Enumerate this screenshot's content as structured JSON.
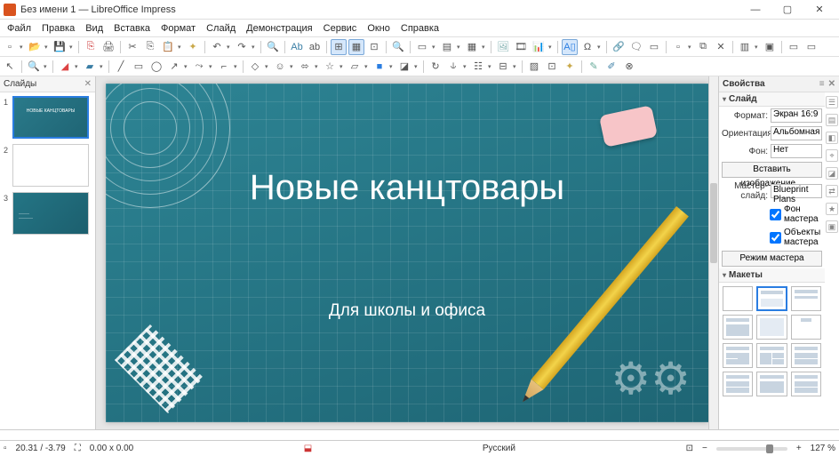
{
  "window": {
    "title": "Без имени 1 — LibreOffice Impress"
  },
  "menu": [
    "Файл",
    "Правка",
    "Вид",
    "Вставка",
    "Формат",
    "Слайд",
    "Демонстрация",
    "Сервис",
    "Окно",
    "Справка"
  ],
  "panels": {
    "slides_title": "Слайды",
    "props_title": "Свойства",
    "section_slide": "Слайд",
    "section_layouts": "Макеты"
  },
  "properties": {
    "format_label": "Формат:",
    "format_value": "Экран 16:9",
    "orientation_label": "Ориентация:",
    "orientation_value": "Альбомная",
    "background_label": "Фон:",
    "background_value": "Нет",
    "insert_image_btn": "Вставить изображение...",
    "master_label": "Мастер-слайд:",
    "master_value": "Blueprint Plans",
    "master_bg_checkbox": "Фон мастера",
    "master_objects_checkbox": "Объекты мастера",
    "master_mode_btn": "Режим мастера"
  },
  "slide_content": {
    "title": "Новые канцтовары",
    "subtitle": "Для школы и офиса"
  },
  "status": {
    "coords": "20.31 / -3.79",
    "size": "0.00 x 0.00",
    "language": "Русский",
    "zoom": "127 %"
  },
  "slides": [
    1,
    2,
    3
  ]
}
